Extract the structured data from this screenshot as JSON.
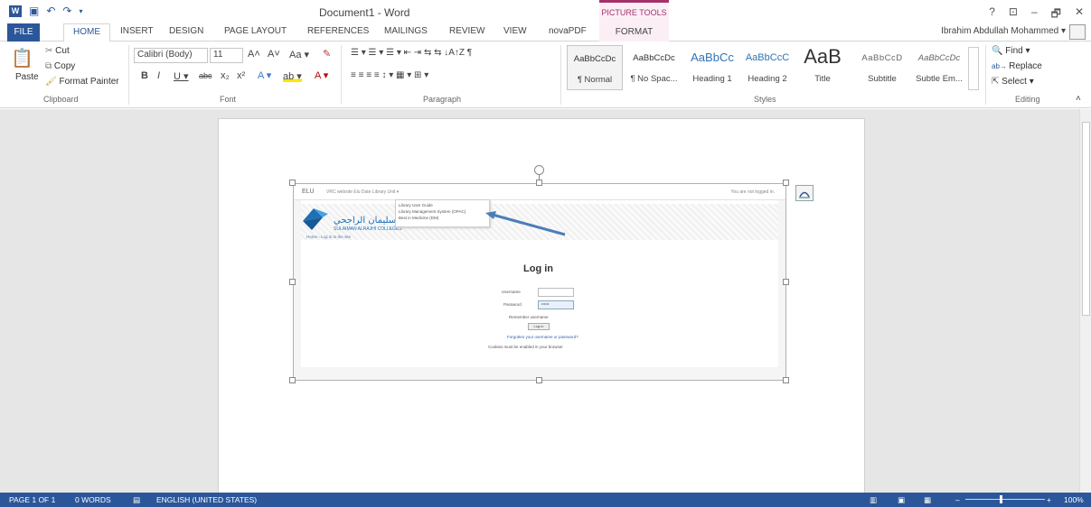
{
  "title_bar": {
    "doc_title": "Document1 - Word",
    "context_title": "PICTURE TOOLS",
    "controls": [
      "?",
      "⊡",
      "–",
      "🗗",
      "✕"
    ],
    "qat": [
      "↶",
      "↷"
    ]
  },
  "tabs": [
    {
      "label": "FILE"
    },
    {
      "label": "HOME"
    },
    {
      "label": "INSERT"
    },
    {
      "label": "DESIGN"
    },
    {
      "label": "PAGE LAYOUT"
    },
    {
      "label": "REFERENCES"
    },
    {
      "label": "MAILINGS"
    },
    {
      "label": "REVIEW"
    },
    {
      "label": "VIEW"
    },
    {
      "label": "novaPDF"
    },
    {
      "label": "FORMAT"
    }
  ],
  "user": {
    "name": "Ibrahim Abdullah Mohammed ▾"
  },
  "clipboard": {
    "paste": "Paste",
    "cut": "Cut",
    "copy": "Copy",
    "format_painter": "Format Painter",
    "label": "Clipboard"
  },
  "font": {
    "family": "Calibri (Body)",
    "size": "11",
    "grow": "A˄",
    "shrink": "A˅",
    "case": "Aa ▾",
    "bold": "B",
    "italic": "I",
    "underline": "U ▾",
    "strike": "abc",
    "sub": "x₂",
    "sup": "x²",
    "effects": "A ▾",
    "highlight": "ab ▾",
    "color": "A ▾",
    "label": "Font"
  },
  "paragraph": {
    "label": "Paragraph",
    "row1": "☰ ▾  ☰ ▾  ☰ ▾   ⇤ ⇥   ⇆ ⇆   ↓A↑Z   ¶",
    "row2": "≡  ≡  ≡  ≡   ↕ ▾   ▦ ▾  ⊞ ▾"
  },
  "styles": {
    "label": "Styles",
    "items": [
      {
        "sample": "AaBbCcDc",
        "name": "¶ Normal"
      },
      {
        "sample": "AaBbCcDc",
        "name": "¶ No Spac..."
      },
      {
        "sample": "AaBbCc",
        "name": "Heading 1"
      },
      {
        "sample": "AaBbCcC",
        "name": "Heading 2"
      },
      {
        "sample": "AaB",
        "name": "Title"
      },
      {
        "sample": "AaBbCcD",
        "name": "Subtitle"
      },
      {
        "sample": "AaBbCcDc",
        "name": "Subtle Em..."
      }
    ]
  },
  "editing": {
    "find": "Find ▾",
    "replace": "Replace",
    "select": "Select ▾",
    "label": "Editing"
  },
  "picture": {
    "nav_brand": "ELU",
    "nav_links": "VRC website    Elu Date    Library Unit ▾",
    "nav_status": "You are not logged in.",
    "menu_items": [
      "Library User Guide",
      "Library Management System (OPAC)",
      "Best in Medicine (DM)"
    ],
    "logo_arabic": "كليات سليمان الراجحي",
    "logo_english": "SULAIMAN ALRAJHI COLLEGES",
    "breadcrumb": "Home  ›  Log in to the site",
    "login_title": "Log in",
    "username_label": "Username",
    "password_label": "Password",
    "password_value": "••••••",
    "remember": "Remember username",
    "login_btn": "Log in",
    "forgot": "Forgotten your username or password?",
    "cookies": "Cookies must be enabled in your browser"
  },
  "status": {
    "page": "PAGE 1 OF 1",
    "words": "0 WORDS",
    "language": "ENGLISH (UNITED STATES)",
    "zoom": "100%"
  },
  "colors": {
    "word_blue": "#2b579a",
    "picture_tools": "#a5316b",
    "heading_blue": "#2e74b5",
    "arrow": "#4a7eb8"
  }
}
